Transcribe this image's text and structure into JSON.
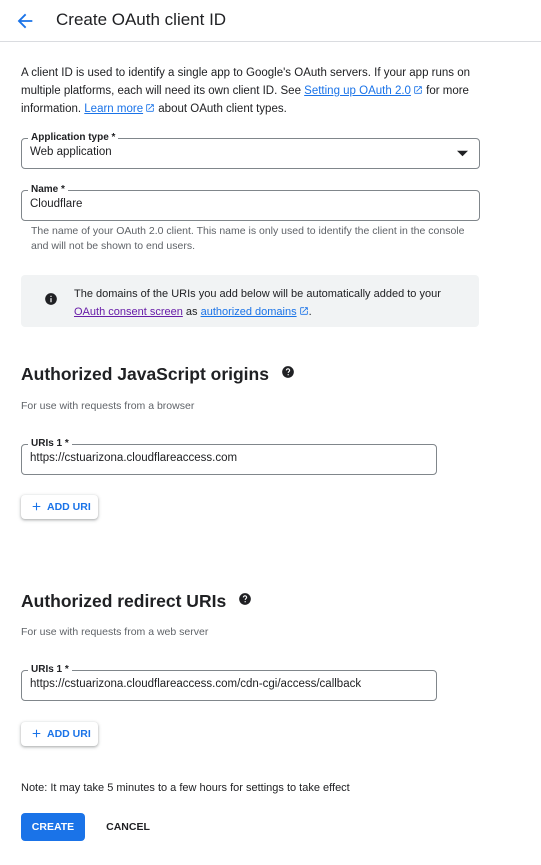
{
  "header": {
    "title": "Create OAuth client ID"
  },
  "intro": {
    "part1": "A client ID is used to identify a single app to Google's OAuth servers. If your app runs on multiple platforms, each will need its own client ID. See ",
    "link1": "Setting up OAuth 2.0",
    "part2": " for more information. ",
    "link2": "Learn more",
    "part3": " about OAuth client types."
  },
  "app_type": {
    "label": "Application type *",
    "value": "Web application"
  },
  "name_field": {
    "label": "Name *",
    "value": "Cloudflare",
    "hint": "The name of your OAuth 2.0 client. This name is only used to identify the client in the console and will not be shown to end users."
  },
  "info": {
    "text1": "The domains of the URIs you add below will be automatically added to your ",
    "link1": "OAuth consent screen",
    "text2": " as ",
    "link2": "authorized domains",
    "text3": "."
  },
  "js_origins": {
    "title": "Authorized JavaScript origins",
    "subtitle": "For use with requests from a browser",
    "uri_label": "URIs 1 *",
    "uri_value": "https://cstuarizona.cloudflareaccess.com",
    "add_label": "ADD URI"
  },
  "redirect_uris": {
    "title": "Authorized redirect URIs",
    "subtitle": "For use with requests from a web server",
    "uri_label": "URIs 1 *",
    "uri_value": "https://cstuarizona.cloudflareaccess.com/cdn-cgi/access/callback",
    "add_label": "ADD URI"
  },
  "note": "Note: It may take 5 minutes to a few hours for settings to take effect",
  "actions": {
    "create": "CREATE",
    "cancel": "CANCEL"
  },
  "colors": {
    "accent": "#1a73e8",
    "visited_link": "#681da8",
    "info_bg": "#f1f3f4"
  }
}
